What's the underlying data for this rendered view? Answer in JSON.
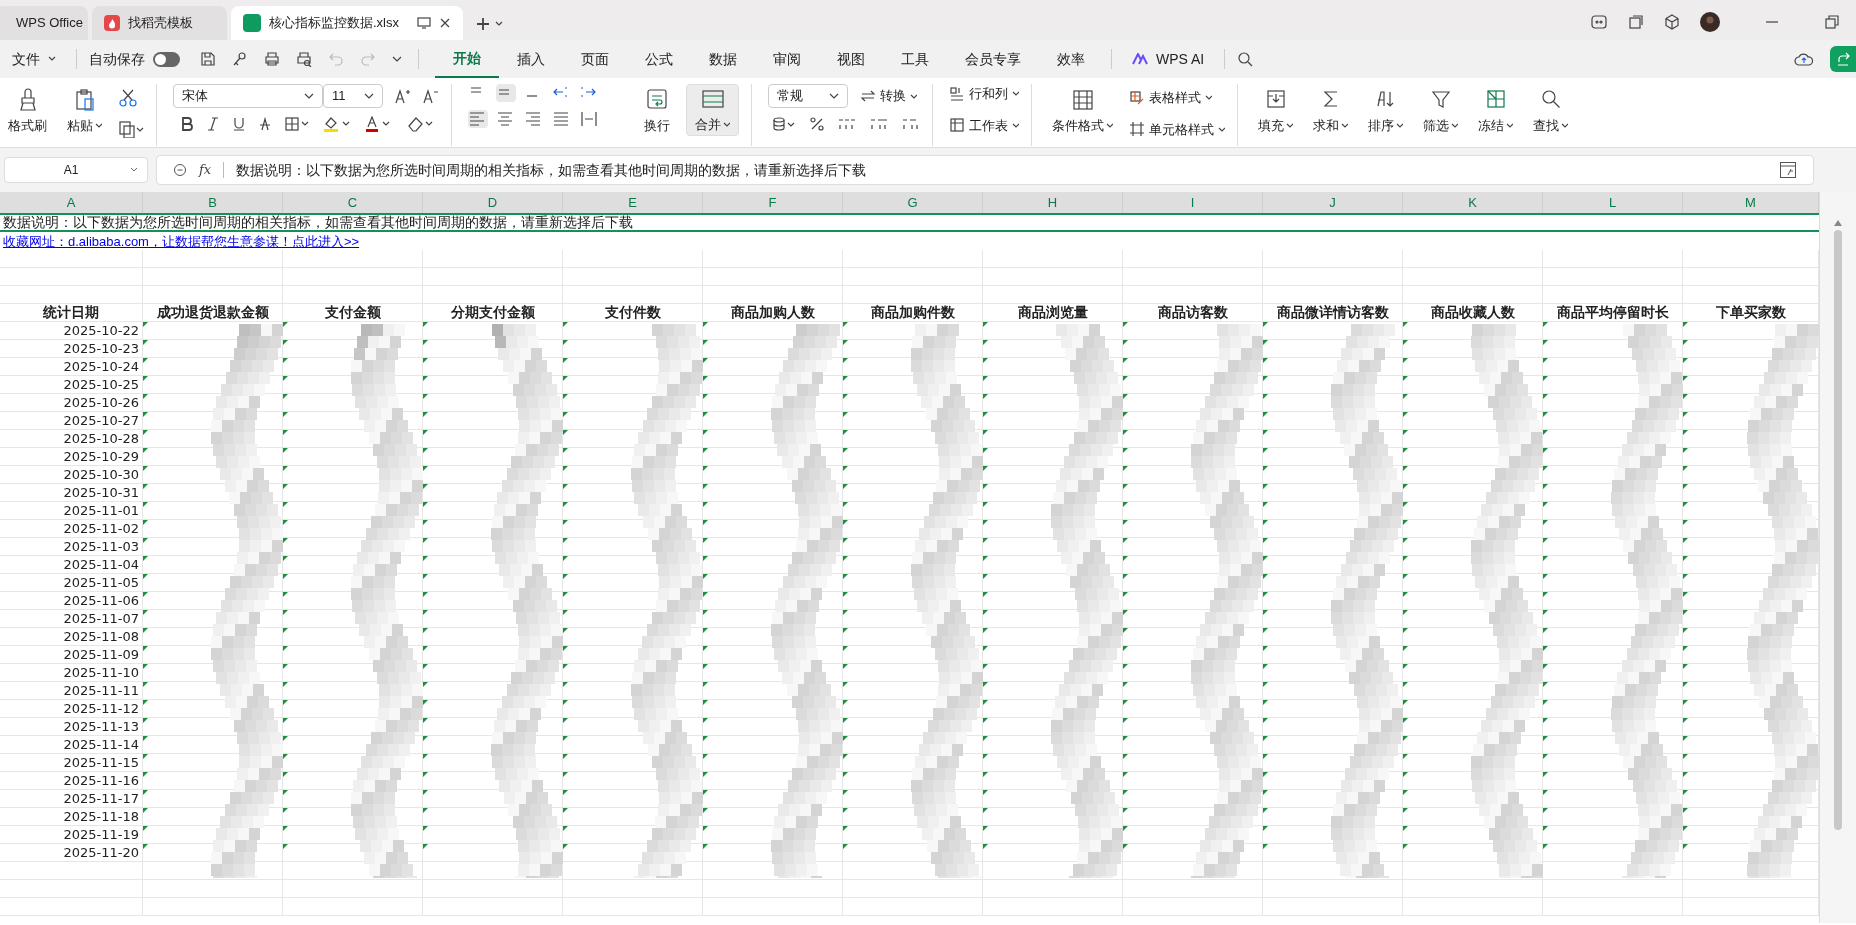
{
  "app_tabs": [
    {
      "label": "WPS Office",
      "selected": false,
      "kind": "home"
    },
    {
      "label": "找稻壳模板",
      "selected": false,
      "kind": "template"
    },
    {
      "label": "核心指标监控数据.xlsx",
      "selected": true,
      "kind": "sheet"
    }
  ],
  "menu": {
    "file": "文件",
    "autosave": {
      "label": "自动保存",
      "on": false
    },
    "tabs": [
      {
        "label": "开始",
        "selected": true
      },
      {
        "label": "插入",
        "selected": false
      },
      {
        "label": "页面",
        "selected": false
      },
      {
        "label": "公式",
        "selected": false
      },
      {
        "label": "数据",
        "selected": false
      },
      {
        "label": "审阅",
        "selected": false
      },
      {
        "label": "视图",
        "selected": false
      },
      {
        "label": "工具",
        "selected": false
      },
      {
        "label": "会员专享",
        "selected": false
      },
      {
        "label": "效率",
        "selected": false
      }
    ],
    "ai": "WPS AI"
  },
  "ribbon": {
    "format_painter": "格式刷",
    "paste": "粘贴",
    "font": "宋体",
    "font_size": "11",
    "wrap": "换行",
    "merge": "合并",
    "number_format": "常规",
    "convert": "转换",
    "rows_cols": "行和列",
    "worksheet": "工作表",
    "cond_format": "条件格式",
    "table_style": "表格样式",
    "cell_style": "单元格样式",
    "tools": [
      "填充",
      "求和",
      "排序",
      "筛选",
      "冻结",
      "查找"
    ]
  },
  "formula_bar": {
    "cell_ref": "A1",
    "fx_label": "fx",
    "formula": "数据说明：以下数据为您所选时间周期的相关指标，如需查看其他时间周期的数据，请重新选择后下载"
  },
  "sheet": {
    "description": "数据说明：以下数据为您所选时间周期的相关指标，如需查看其他时间周期的数据，请重新选择后下载",
    "link": "收藏网址：d.alibaba.com，让数据帮您生意参谋！点此进入>>",
    "columns": [
      {
        "letter": "A",
        "header": "统计日期",
        "obscured": false,
        "marked": false
      },
      {
        "letter": "B",
        "header": "成功退货退款金额",
        "obscured": true,
        "marked": true
      },
      {
        "letter": "C",
        "header": "支付金额",
        "obscured": true,
        "marked": true
      },
      {
        "letter": "D",
        "header": "分期支付金额",
        "obscured": true,
        "marked": true
      },
      {
        "letter": "E",
        "header": "支付件数",
        "obscured": true,
        "marked": true
      },
      {
        "letter": "F",
        "header": "商品加购人数",
        "obscured": true,
        "marked": true
      },
      {
        "letter": "G",
        "header": "商品加购件数",
        "obscured": true,
        "marked": true
      },
      {
        "letter": "H",
        "header": "商品浏览量",
        "obscured": true,
        "marked": true
      },
      {
        "letter": "I",
        "header": "商品访客数",
        "obscured": true,
        "marked": true
      },
      {
        "letter": "J",
        "header": "商品微详情访客数",
        "obscured": true,
        "marked": true
      },
      {
        "letter": "K",
        "header": "商品收藏人数",
        "obscured": true,
        "marked": true
      },
      {
        "letter": "L",
        "header": "商品平均停留时长",
        "obscured": true,
        "marked": true
      },
      {
        "letter": "M",
        "header": "下单买家数",
        "obscured": true,
        "marked": true
      }
    ],
    "dates": [
      "2025-10-22",
      "2025-10-23",
      "2025-10-24",
      "2025-10-25",
      "2025-10-26",
      "2025-10-27",
      "2025-10-28",
      "2025-10-29",
      "2025-10-30",
      "2025-10-31",
      "2025-11-01",
      "2025-11-02",
      "2025-11-03",
      "2025-11-04",
      "2025-11-05",
      "2025-11-06",
      "2025-11-07",
      "2025-11-08",
      "2025-11-09",
      "2025-11-10",
      "2025-11-11",
      "2025-11-12",
      "2025-11-13",
      "2025-11-14",
      "2025-11-15",
      "2025-11-16",
      "2025-11-17",
      "2025-11-18",
      "2025-11-19",
      "2025-11-20"
    ]
  }
}
